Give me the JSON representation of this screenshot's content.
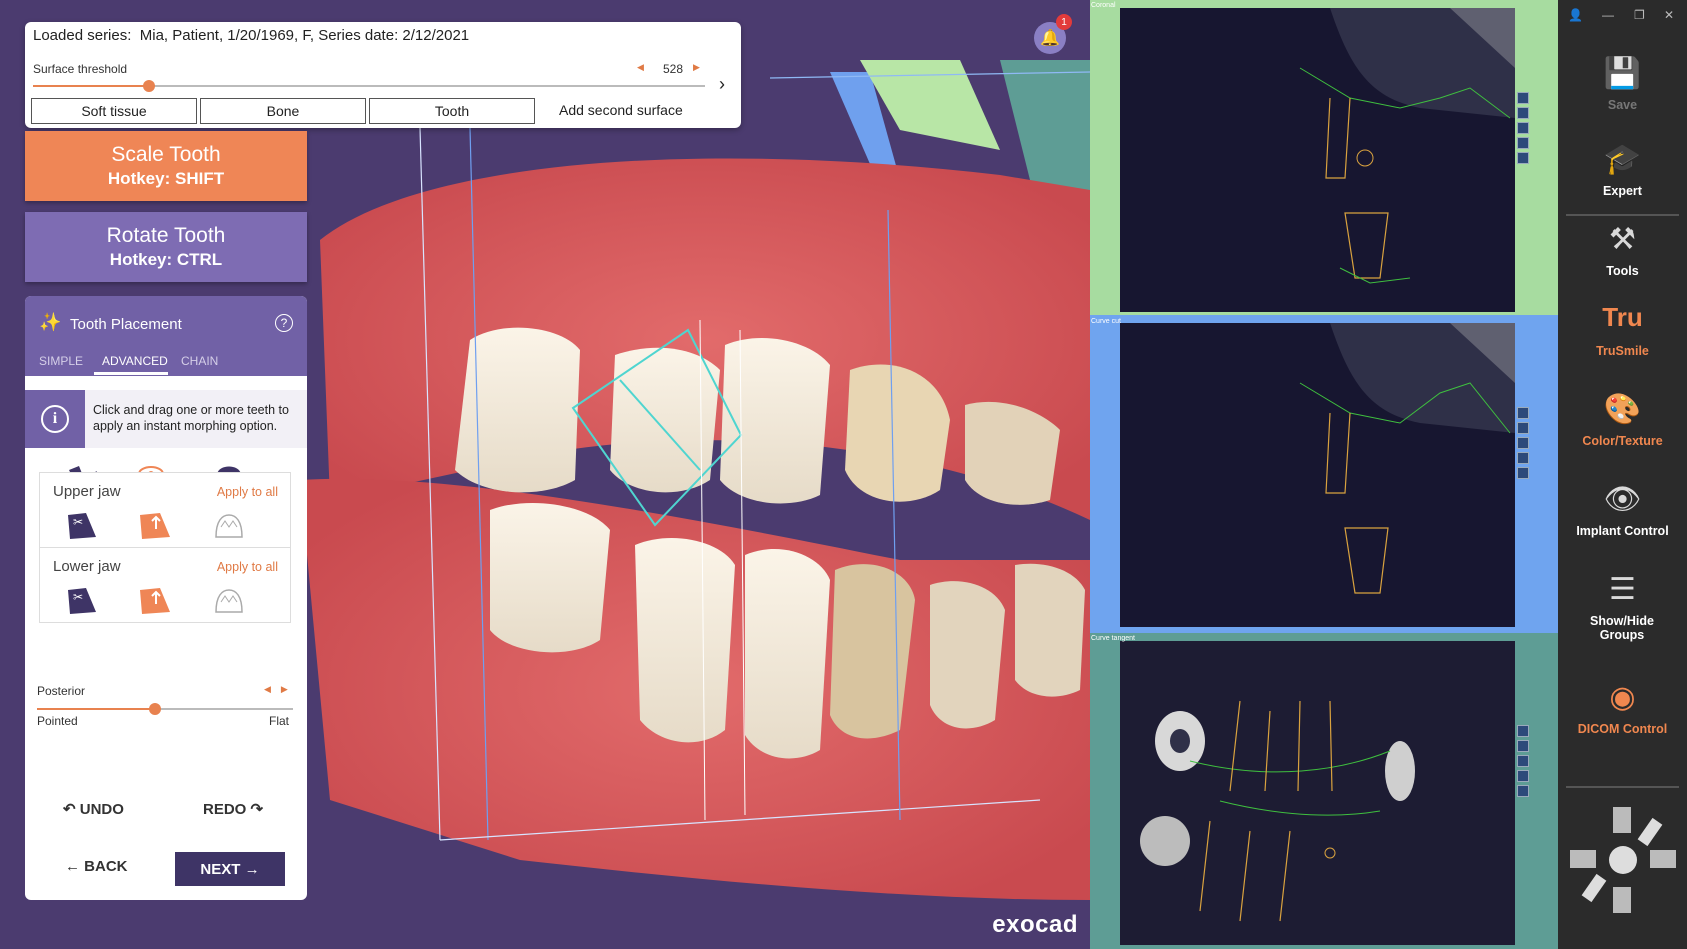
{
  "top_panel": {
    "series_label": "Loaded series:",
    "series_value": "Mia, Patient, 1/20/1969, F, Series date: 2/12/2021",
    "threshold_label": "Surface threshold",
    "threshold_value": "528",
    "buttons": [
      "Soft tissue",
      "Bone",
      "Tooth"
    ],
    "add_surface": "Add second surface"
  },
  "notification_count": "1",
  "scale_button": {
    "title": "Scale Tooth",
    "hotkey": "Hotkey: SHIFT"
  },
  "rotate_button": {
    "title": "Rotate Tooth",
    "hotkey": "Hotkey: CTRL"
  },
  "tooth_placement": {
    "title": "Tooth Placement",
    "tabs": [
      "SIMPLE",
      "ADVANCED",
      "CHAIN"
    ],
    "active_tab": "ADVANCED",
    "info": "Click and drag one or more teeth to apply an instant morphing option.",
    "upper_jaw": {
      "label": "Upper jaw",
      "apply": "Apply to all"
    },
    "lower_jaw": {
      "label": "Lower jaw",
      "apply": "Apply to all"
    },
    "posterior_label": "Posterior",
    "posterior_level": 0.46,
    "pointed": "Pointed",
    "flat": "Flat",
    "undo": "UNDO",
    "redo": "REDO",
    "back": "BACK",
    "next": "NEXT"
  },
  "ct_panels": [
    {
      "label": "Coronal",
      "color": "#a7dca0"
    },
    {
      "label": "Curve cut",
      "color": "#6fa4ef"
    },
    {
      "label": "Curve tangent",
      "color": "#5e9d95"
    }
  ],
  "sidebar": {
    "items": [
      {
        "label": "Save",
        "icon": "save-icon"
      },
      {
        "label": "Expert",
        "icon": "expert-icon"
      },
      {
        "label": "Tools",
        "icon": "tools-icon"
      },
      {
        "label": "TruSmile",
        "icon": "trusmile-icon"
      },
      {
        "label": "Color/Texture",
        "icon": "color-texture-icon"
      },
      {
        "label": "Implant Control",
        "icon": "implant-control-icon"
      },
      {
        "label": "Show/Hide Groups",
        "icon": "show-hide-groups-icon"
      },
      {
        "label": "DICOM Control",
        "icon": "dicom-control-icon"
      }
    ]
  },
  "logo": "exocad",
  "colors": {
    "accent": "#ef8656",
    "purple": "#7161a6",
    "dark_purple": "#3e3466"
  }
}
